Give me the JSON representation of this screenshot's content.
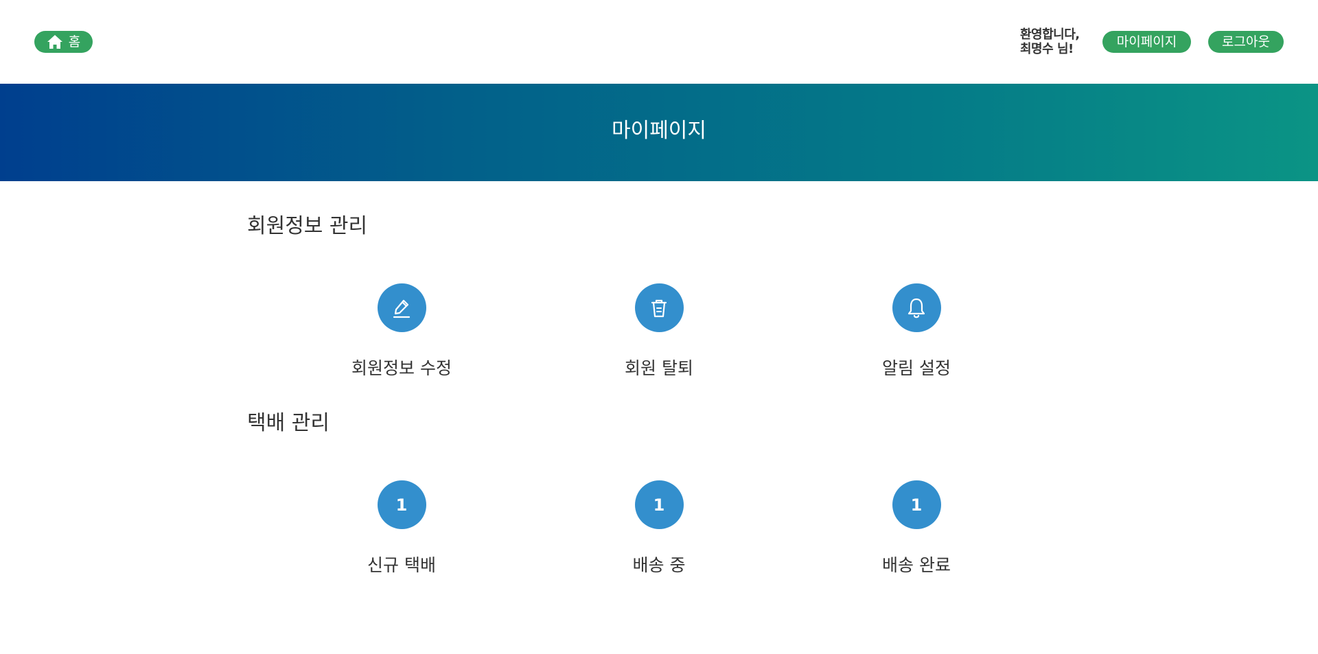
{
  "header": {
    "home_label": "홈",
    "welcome_line1": "환영합니다,",
    "welcome_line2": "최명수 님!",
    "mypage_label": "마이페이지",
    "logout_label": "로그아웃"
  },
  "banner": {
    "title": "마이페이지"
  },
  "member_section": {
    "title": "회원정보 관리",
    "items": [
      {
        "label": "회원정보 수정",
        "icon": "pencil-icon"
      },
      {
        "label": "회원 탈퇴",
        "icon": "trash-icon"
      },
      {
        "label": "알림 설정",
        "icon": "bell-icon"
      }
    ]
  },
  "delivery_section": {
    "title": "택배 관리",
    "items": [
      {
        "label": "신규 택배",
        "count": "1"
      },
      {
        "label": "배송 중",
        "count": "1"
      },
      {
        "label": "배송 완료",
        "count": "1"
      }
    ]
  },
  "colors": {
    "accent_green": "#34a35f",
    "icon_blue": "#338fcd",
    "banner_start": "#003f8e",
    "banner_end": "#0b9485"
  }
}
